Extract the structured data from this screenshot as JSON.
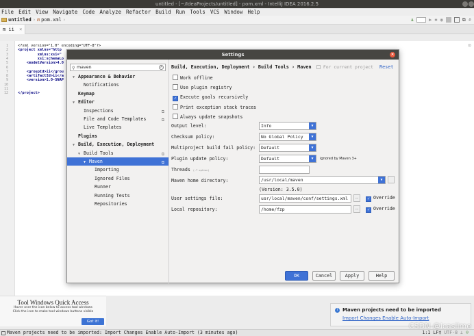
{
  "window": {
    "title": "untitled - [~/IdeaProjects/untitled] - pom.xml - IntelliJ IDEA 2016.2.5"
  },
  "menu": [
    "File",
    "Edit",
    "View",
    "Navigate",
    "Code",
    "Analyze",
    "Refactor",
    "Build",
    "Run",
    "Tools",
    "VCS",
    "Window",
    "Help"
  ],
  "breadcrumb": {
    "project": "untitled",
    "file": "pom.xml"
  },
  "tab": {
    "label": "m ii"
  },
  "editor": {
    "lines": [
      "1",
      "2",
      "3",
      "4",
      "5",
      "6",
      "7",
      "8",
      "9",
      "10",
      "11",
      "12"
    ],
    "code": [
      "<?xml version=\"1.0\" encoding=\"UTF-8\"?>",
      "<project xmlns=\"http",
      "         xmlns:xsi=\"",
      "         xsi:schemaLo",
      "    <modelVersion>4.0",
      "",
      "    <groupId>ii</grou",
      "    <artifactId>ii</a",
      "    <version>1.0-SNAP",
      "",
      "",
      "</project>"
    ]
  },
  "dialog": {
    "title": "Settings",
    "search_value": "maven",
    "tree": [
      {
        "label": "Appearance & Behavior",
        "bold": true,
        "tri": "▼",
        "indent": 0,
        "copy": false,
        "selected": false
      },
      {
        "label": "Notifications",
        "bold": false,
        "tri": "",
        "indent": 1,
        "copy": false,
        "selected": false
      },
      {
        "label": "Keymap",
        "bold": true,
        "tri": "",
        "indent": 0,
        "copy": false,
        "selected": false
      },
      {
        "label": "Editor",
        "bold": true,
        "tri": "▼",
        "indent": 0,
        "copy": false,
        "selected": false
      },
      {
        "label": "Inspections",
        "bold": false,
        "tri": "",
        "indent": 1,
        "copy": true,
        "selected": false
      },
      {
        "label": "File and Code Templates",
        "bold": false,
        "tri": "",
        "indent": 1,
        "copy": true,
        "selected": false
      },
      {
        "label": "Live Templates",
        "bold": false,
        "tri": "",
        "indent": 1,
        "copy": false,
        "selected": false
      },
      {
        "label": "Plugins",
        "bold": true,
        "tri": "",
        "indent": 0,
        "copy": false,
        "selected": false
      },
      {
        "label": "Build, Execution, Deployment",
        "bold": true,
        "tri": "▼",
        "indent": 0,
        "copy": false,
        "selected": false
      },
      {
        "label": "Build Tools",
        "bold": false,
        "tri": "▼",
        "indent": 1,
        "copy": true,
        "selected": false
      },
      {
        "label": "Maven",
        "bold": false,
        "tri": "▼",
        "indent": 2,
        "copy": true,
        "selected": true
      },
      {
        "label": "Importing",
        "bold": false,
        "tri": "",
        "indent": 3,
        "copy": false,
        "selected": false
      },
      {
        "label": "Ignored Files",
        "bold": false,
        "tri": "",
        "indent": 3,
        "copy": false,
        "selected": false
      },
      {
        "label": "Runner",
        "bold": false,
        "tri": "",
        "indent": 3,
        "copy": false,
        "selected": false
      },
      {
        "label": "Running Tests",
        "bold": false,
        "tri": "",
        "indent": 3,
        "copy": false,
        "selected": false
      },
      {
        "label": "Repositories",
        "bold": false,
        "tri": "",
        "indent": 3,
        "copy": false,
        "selected": false
      }
    ],
    "header": {
      "path": "Build, Execution, Deployment › Build Tools › Maven",
      "scope": "For current project",
      "reset": "Reset"
    },
    "checkboxes": [
      {
        "label": "Work offline",
        "checked": false
      },
      {
        "label": "Use plugin registry",
        "checked": false
      },
      {
        "label": "Execute goals recursively",
        "checked": true
      },
      {
        "label": "Print exception stack traces",
        "checked": false
      },
      {
        "label": "Always update snapshots",
        "checked": false
      }
    ],
    "fields": {
      "output_level_label": "Output level:",
      "output_level": "Info",
      "checksum_label": "Checksum policy:",
      "checksum": "No Global Policy",
      "multiproject_label": "Multiproject build fail policy:",
      "multiproject": "Default",
      "plugin_update_label": "Plugin update policy:",
      "plugin_update": "Default",
      "plugin_update_note": "ignored by Maven 3+",
      "threads_label": "Threads",
      "threads_hint": "(-T option)",
      "threads": "",
      "maven_home_label": "Maven home directory:",
      "maven_home": "/usr/local/maven",
      "version": "(Version: 3.5.0)",
      "settings_file_label": "User settings file:",
      "settings_file": "usr/local/maven/conf/settings.xml",
      "local_repo_label": "Local repository:",
      "local_repo": "/home/fzp",
      "override_label": "Override"
    },
    "buttons": {
      "ok": "OK",
      "cancel": "Cancel",
      "apply": "Apply",
      "help": "Help"
    }
  },
  "quick_access": {
    "title": "Tool Windows Quick Access",
    "line1": "Hover over the icon below to access tool windows",
    "line2": "Click the icon to make tool windows buttons visible",
    "button": "Got it!"
  },
  "notification": {
    "title": "Maven projects need to be imported",
    "links": "Import Changes Enable Auto-Import"
  },
  "status": {
    "text": "Maven projects need to be imported: Import Changes Enable Auto-Import (3 minutes ago)",
    "position": "1:1",
    "line_sep": "LF‡",
    "encoding": "UTF-8"
  },
  "watermark": "CSDN @icaslime",
  "colors": {
    "accent": "#3f72d6",
    "titlebar": "#3b3a36",
    "close": "#e9553a",
    "link": "#2d62c6"
  }
}
